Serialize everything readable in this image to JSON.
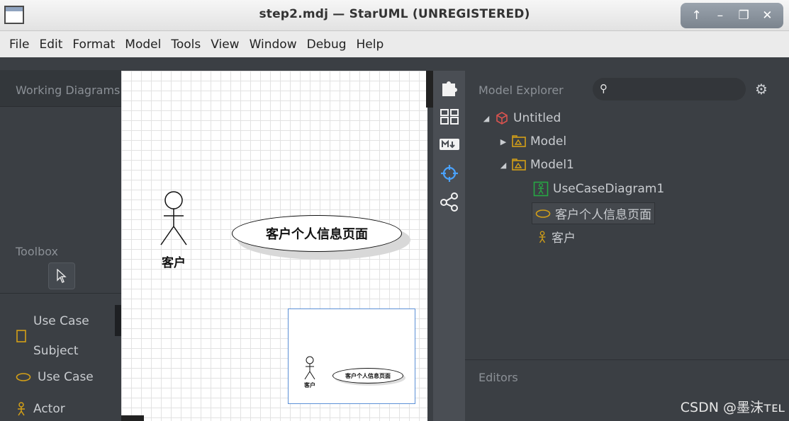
{
  "window": {
    "title": "step2.mdj — StarUML (UNREGISTERED)",
    "buttons": [
      "↑",
      "–",
      "❐",
      "✕"
    ]
  },
  "menubar": {
    "items": [
      "File",
      "Edit",
      "Format",
      "Model",
      "Tools",
      "View",
      "Window",
      "Debug",
      "Help"
    ]
  },
  "working_diagrams": {
    "title": "Working Diagrams"
  },
  "toolbox": {
    "title": "Toolbox",
    "items": [
      "Use Case Subject",
      "Use Case",
      "Actor"
    ]
  },
  "diagram": {
    "actor_name": "客户",
    "usecase_name": "客户个人信息页面"
  },
  "minimap": {
    "actor_name": "客户",
    "usecase_name": "客户个人信息页面"
  },
  "model_explorer": {
    "title": "Model Explorer",
    "search_placeholder": "",
    "tree": {
      "root": "Untitled",
      "model": "Model",
      "model1": "Model1",
      "diagram": "UseCaseDiagram1",
      "usecase": "客户个人信息页面",
      "actor": "客户"
    }
  },
  "editors": {
    "title": "Editors"
  },
  "watermark": "CSDN @墨沫ᴛᴇʟ",
  "colors": {
    "panel_bg": "#3b3f44",
    "icon_gold": "#d4a017",
    "icon_green": "#27a844",
    "icon_red": "#d9534f",
    "icon_blue": "#4aa3ff"
  }
}
